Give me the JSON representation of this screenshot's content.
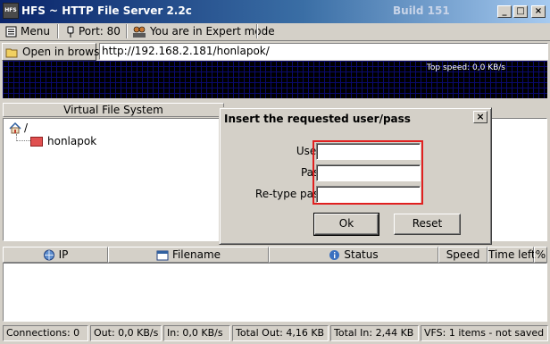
{
  "window": {
    "app_icon_text": "HFS",
    "title": "HFS ~ HTTP File Server 2.2c",
    "build": "Build 151",
    "minimize": "_",
    "maximize": "□",
    "close": "×"
  },
  "toolbar": {
    "menu_label": "Menu",
    "port_label": "Port: 80",
    "mode_label": "You are in Expert mode"
  },
  "urlbar": {
    "open_label": "Open in browser",
    "url": "http://192.168.2.181/honlapok/"
  },
  "graph": {
    "top_speed": "Top speed: 0,0 KB/s"
  },
  "vfs": {
    "header": "Virtual File System",
    "root": "/",
    "items": [
      {
        "label": "honlapok"
      }
    ]
  },
  "dialog": {
    "title": "Insert the requested user/pass",
    "close": "×",
    "username_label": "Username",
    "password_label": "Password",
    "retype_label": "Re-type password",
    "username_value": "",
    "password_value": "",
    "retype_value": "",
    "ok_label": "Ok",
    "reset_label": "Reset",
    "highlight_color": "#e02020"
  },
  "connections": {
    "columns": [
      "IP",
      "Filename",
      "Status",
      "Speed",
      "Time left",
      "%"
    ]
  },
  "status": {
    "connections": "Connections: 0",
    "out": "Out: 0,0 KB/s",
    "in": "In: 0,0 KB/s",
    "total_out": "Total Out: 4,16 KB",
    "total_in": "Total In: 2,44 KB",
    "vfs": "VFS: 1 items - not saved"
  },
  "colors": {
    "titlebar_start": "#0a246a",
    "titlebar_end": "#a6caf0",
    "graph_bg": "#000000",
    "face": "#d4d0c8"
  }
}
